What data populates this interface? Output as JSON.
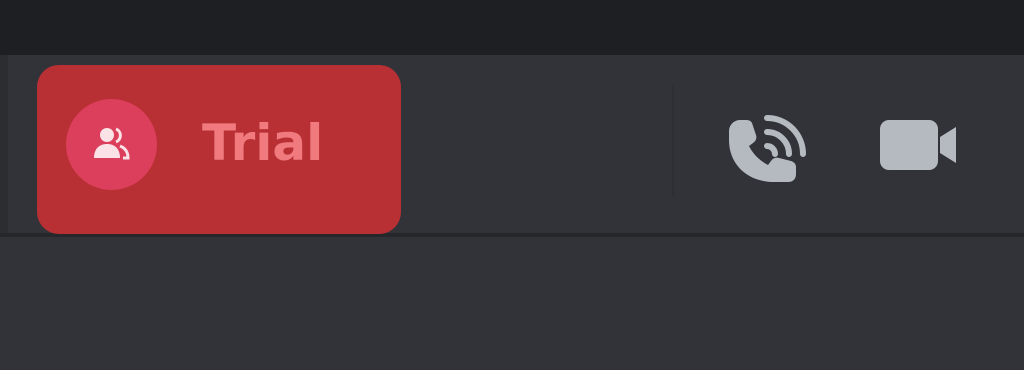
{
  "header": {
    "channel": {
      "name": "Trial",
      "avatar_icon": "group-dm-icon",
      "pill_color": "#b83034",
      "avatar_color": "#dc3f5b",
      "name_color": "#f07a7e"
    },
    "actions": [
      {
        "icon": "voice-call-icon"
      },
      {
        "icon": "video-call-icon"
      }
    ],
    "icon_color": "#b5bac1"
  },
  "theme": {
    "background": "#313338",
    "top_strip": "#1e1f22"
  }
}
